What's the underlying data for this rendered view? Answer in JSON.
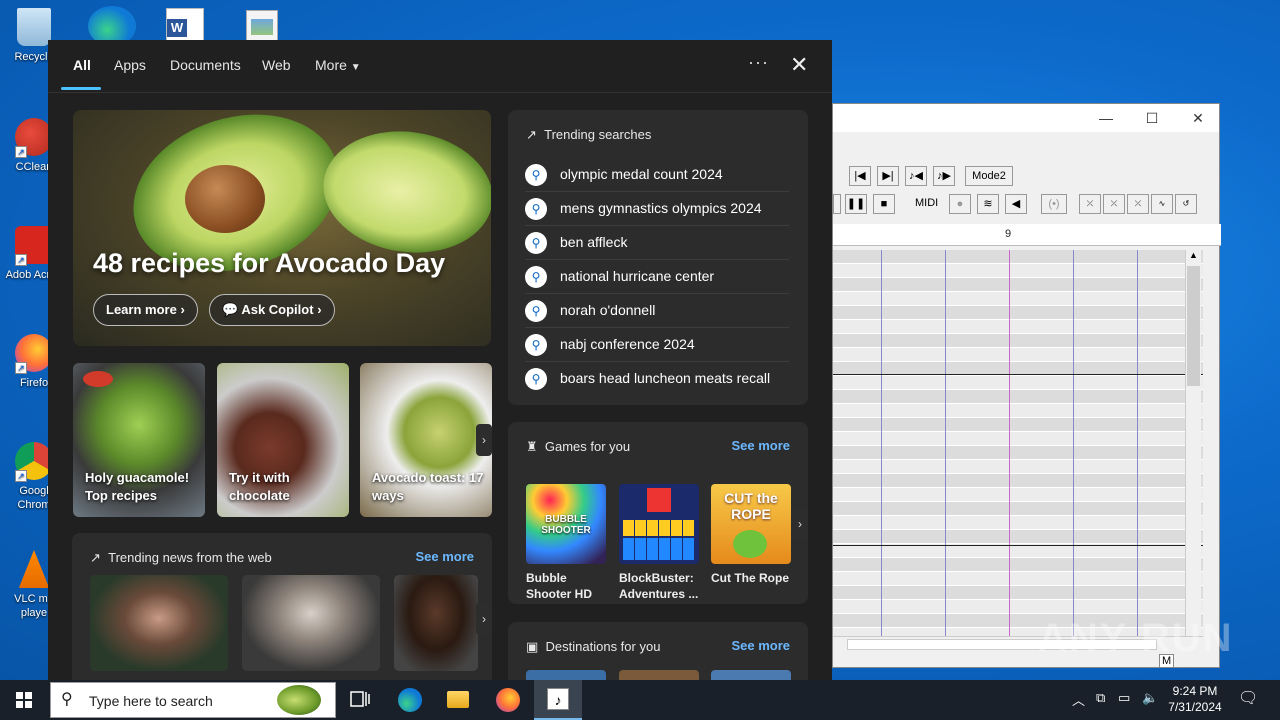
{
  "desktop": {
    "icons": [
      {
        "label": "Recycle",
        "name": "recycle-bin"
      },
      {
        "label": "CClean",
        "name": "ccleaner"
      },
      {
        "label": "Adob Acrob",
        "name": "adobe-acrobat"
      },
      {
        "label": "Firefo",
        "name": "firefox"
      },
      {
        "label": "Googl Chrom",
        "name": "chrome"
      },
      {
        "label": "VLC me playe",
        "name": "vlc"
      }
    ]
  },
  "app_window": {
    "mode_button": "Mode2",
    "midi_label": "MIDI",
    "ruler_mark": "9",
    "status_letter": "M"
  },
  "search_panel": {
    "tabs": [
      {
        "label": "All"
      },
      {
        "label": "Apps"
      },
      {
        "label": "Documents"
      },
      {
        "label": "Web"
      },
      {
        "label": "More"
      }
    ],
    "more_options": "···",
    "close": "✕",
    "hero": {
      "title": "48 recipes for Avocado Day",
      "learn_more": "Learn more",
      "ask_copilot": "Ask Copilot"
    },
    "cards": [
      {
        "text": "Holy guacamole! Top recipes"
      },
      {
        "text": "Try it with chocolate"
      },
      {
        "text": "Avocado toast: 17 ways"
      }
    ],
    "trending_searches": {
      "title": "Trending searches",
      "items": [
        "olympic medal count 2024",
        "mens gymnastics olympics 2024",
        "ben affleck",
        "national hurricane center",
        "norah o'donnell",
        "nabj conference 2024",
        "boars head luncheon meats recall"
      ]
    },
    "games": {
      "title": "Games for you",
      "see_more": "See more",
      "items": [
        {
          "name": "Bubble Shooter HD",
          "thumb_text": "BUBBLE SHOOTER"
        },
        {
          "name": "BlockBuster: Adventures ...",
          "thumb_text": ""
        },
        {
          "name": "Cut The Rope",
          "thumb_text": "CUT the ROPE"
        }
      ]
    },
    "news": {
      "title": "Trending news from the web",
      "see_more": "See more"
    },
    "destinations": {
      "title": "Destinations for you",
      "see_more": "See more"
    }
  },
  "taskbar": {
    "search_placeholder": "Type here to search",
    "time": "9:24 PM",
    "date": "7/31/2024"
  },
  "watermark": "ANY RUN"
}
